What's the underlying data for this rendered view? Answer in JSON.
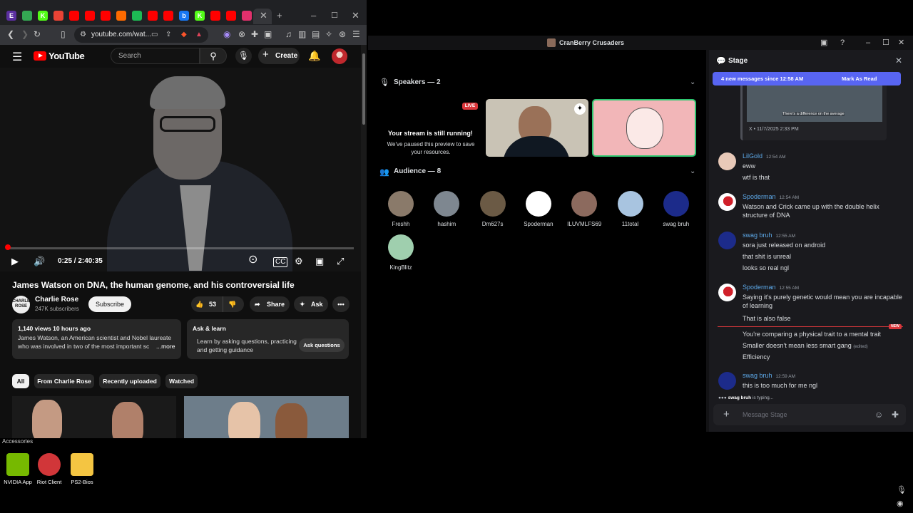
{
  "browser": {
    "url": "youtube.com/wat...",
    "tabs": [
      {
        "name": "e-tab",
        "glyph": "E",
        "color": "#5b2fa0"
      },
      {
        "name": "chrome-tab",
        "glyph": "",
        "color": "#34a853"
      },
      {
        "name": "kick-tab",
        "glyph": "K",
        "color": "#53fc18"
      },
      {
        "name": "mail-tab",
        "glyph": "",
        "color": "#ea4335"
      },
      {
        "name": "youtube-tab-1",
        "glyph": "",
        "color": "#ff0000"
      },
      {
        "name": "youtube-tab-2",
        "glyph": "",
        "color": "#ff0000"
      },
      {
        "name": "youtube-tab-3",
        "glyph": "",
        "color": "#ff0000"
      },
      {
        "name": "orange-tab",
        "glyph": "",
        "color": "#ff6a00"
      },
      {
        "name": "green-tab",
        "glyph": "",
        "color": "#1db954"
      },
      {
        "name": "youtube-tab-4",
        "glyph": "",
        "color": "#ff0000"
      },
      {
        "name": "youtube-tab-5",
        "glyph": "",
        "color": "#ff0000"
      },
      {
        "name": "blue-tab",
        "glyph": "b",
        "color": "#1877f2"
      },
      {
        "name": "kick-tab-2",
        "glyph": "K",
        "color": "#53fc18"
      },
      {
        "name": "youtube-tab-6",
        "glyph": "",
        "color": "#ff0000"
      },
      {
        "name": "youtube-tab-7",
        "glyph": "",
        "color": "#ff0000"
      },
      {
        "name": "instagram-tab",
        "glyph": "",
        "color": "#e1306c"
      }
    ]
  },
  "youtube": {
    "logo_text": "YouTube",
    "search_placeholder": "Search",
    "create_label": "Create",
    "video": {
      "current_time": "0:25 / 2:40:35",
      "progress": 0.003
    },
    "title": "James Watson on DNA, the human genome, and his controversial life",
    "channel": {
      "name": "Charlie Rose",
      "subscribers": "247K subscribers",
      "avatar_text": "CHARLIE ROSE"
    },
    "subscribe_label": "Subscribe",
    "likes": "53",
    "share_label": "Share",
    "ask_label": "Ask",
    "description": {
      "meta": "1,140 views  10 hours ago",
      "text": "James Watson, an American scientist and Nobel laureate who was involved in two of the most important sc",
      "more": "...more"
    },
    "ask_learn": {
      "title": "Ask & learn",
      "text": "Learn by asking questions, practicing and getting guidance",
      "button": "Ask questions"
    },
    "chips": [
      "All",
      "From Charlie Rose",
      "Recently uploaded",
      "Watched"
    ]
  },
  "discord": {
    "window_title": "CranBerry Crusaders",
    "stage": {
      "speakers_label": "Speakers — 2",
      "audience_label": "Audience — 8",
      "live_badge": "LIVE",
      "paused_title": "Your stream is still running!",
      "paused_sub": "We've paused this preview to save your resources.",
      "audience": [
        {
          "name": "Freshh",
          "color": "#8a7a6a"
        },
        {
          "name": "hashim",
          "color": "#7e8790"
        },
        {
          "name": "Dm627s",
          "color": "#6b5a45"
        },
        {
          "name": "Spoderman",
          "color": "#ffffff"
        },
        {
          "name": "ILUVMLFS69",
          "color": "#8c6a5e"
        },
        {
          "name": "11total",
          "color": "#a8c4e0"
        },
        {
          "name": "swag bruh",
          "color": "#1c2b8a"
        },
        {
          "name": "KingBlitz",
          "color": "#9fcfae"
        }
      ]
    },
    "chat": {
      "title": "Stage",
      "new_messages": "4 new messages since 12:58 AM",
      "mark_as_read": "Mark As Read",
      "embed_caption": "There's a difference on the average",
      "embed_footer": "X • 11/7/2025 2:33 PM",
      "messages": [
        {
          "user": "LilGold",
          "time": "12:54 AM",
          "color": "#5da9e9",
          "lines": [
            "eww",
            "wtf is that"
          ]
        },
        {
          "user": "Spoderman",
          "time": "12:54 AM",
          "color": "#5da9e9",
          "lines": [
            "Watson and Crick came up with the double helix structure of DNA"
          ]
        },
        {
          "user": "swag bruh",
          "time": "12:55 AM",
          "color": "#5da9e9",
          "lines": [
            "sora just released on android",
            "that shit is unreal",
            "looks so real ngl"
          ]
        },
        {
          "user": "Spoderman",
          "time": "12:55 AM",
          "color": "#5da9e9",
          "lines": [
            "Saying it's purely genetic would mean you are incapable of learning",
            "That is also false"
          ]
        },
        {
          "user": "",
          "time": "",
          "color": "",
          "lines": [
            "You're comparing a physical trait to a mental trait",
            "Smaller doesn't mean less smart gang",
            "Efficiency"
          ]
        },
        {
          "user": "swag bruh",
          "time": "12:59 AM",
          "color": "#5da9e9",
          "lines": [
            "this is too much for me ngl"
          ]
        }
      ],
      "edited": "(edited)",
      "new_tag": "NEW",
      "typing_user": "swag bruh",
      "typing_text": " is typing...",
      "composer_placeholder": "Message Stage"
    }
  },
  "desktop": {
    "folder_label": "Accessories",
    "icons": [
      {
        "name": "NVIDIA App",
        "color": "#76b900"
      },
      {
        "name": "Riot Client",
        "color": "#d13639"
      },
      {
        "name": "PS2-Bios",
        "color": "#f4c542"
      }
    ]
  }
}
